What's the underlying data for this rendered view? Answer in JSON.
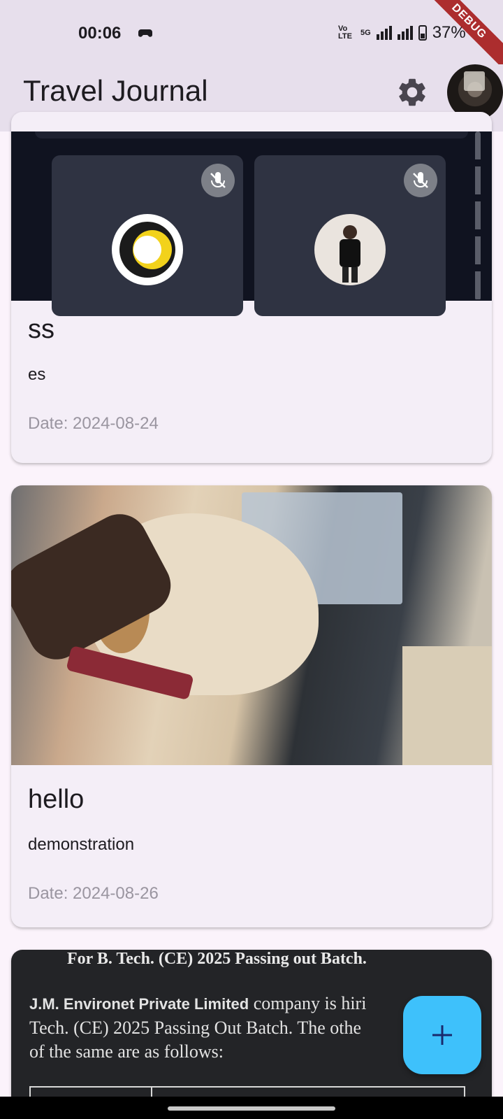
{
  "status_bar": {
    "time": "00:06",
    "volte": "Vo LTE",
    "network": "5G",
    "battery": "37%",
    "debug_banner": "DEBUG"
  },
  "app_bar": {
    "title": "Travel Journal",
    "settings_icon": "gear-icon",
    "avatar_icon": "profile-avatar"
  },
  "entries": [
    {
      "title": "ss",
      "description": "es",
      "date": "Date: 2024-08-24",
      "image": "video-meeting-screenshot"
    },
    {
      "title": "hello",
      "description": "demonstration",
      "date": "Date: 2024-08-26",
      "image": "dog-in-car-photo"
    },
    {
      "image": "document-screenshot",
      "image_text": {
        "heading": "For B. Tech. (CE) 2025 Passing out Batch.",
        "company": "J.M. Environet Private Limited",
        "body_1": " company is hiri",
        "body_2": "Tech. (CE) 2025 Passing Out Batch. The othe",
        "body_3": "of the same are as follows:"
      }
    }
  ],
  "fab": {
    "icon": "plus-icon"
  },
  "colors": {
    "app_bar_bg": "#e7dfec",
    "page_bg": "#fbf3fb",
    "card_bg": "#f4eef7",
    "fab_bg": "#3ec1fb",
    "fab_icon": "#1a2a6c"
  }
}
